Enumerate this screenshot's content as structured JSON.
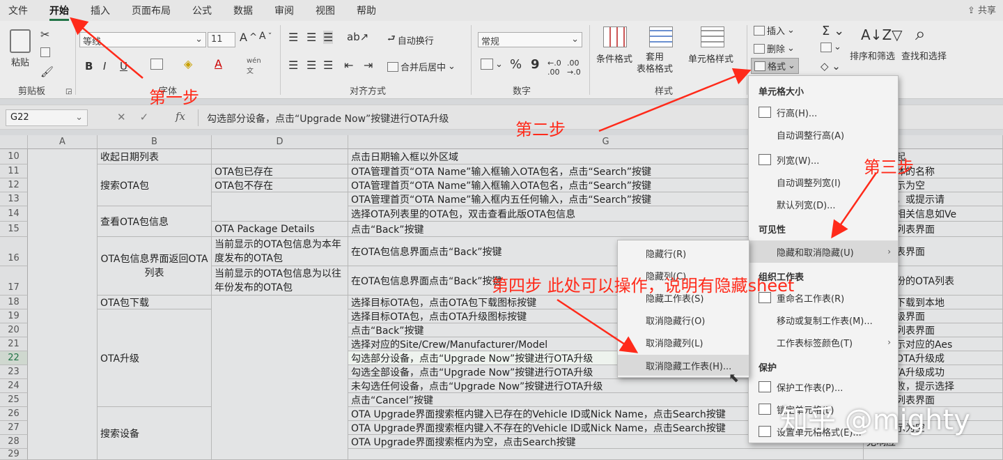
{
  "menubar": {
    "items": [
      "文件",
      "开始",
      "插入",
      "页面布局",
      "公式",
      "数据",
      "审阅",
      "视图",
      "帮助"
    ],
    "share": "共享"
  },
  "ribbon": {
    "clipboard": {
      "paste": "粘贴",
      "label": "剪贴板"
    },
    "font": {
      "name": "等线",
      "size": "11",
      "bold": "B",
      "italic": "I",
      "underline": "U",
      "label": "字体"
    },
    "alignment": {
      "wrap": "自动换行",
      "merge": "合并后居中",
      "label": "对齐方式"
    },
    "number": {
      "format": "常规",
      "percent": "%",
      "comma": "9",
      "label": "数字"
    },
    "styles": {
      "conditional": "条件格式",
      "table": "套用\n表格格式",
      "cell": "单元格样式",
      "label": "样式"
    },
    "cells": {
      "insert": "插入",
      "delete": "删除",
      "format": "格式"
    },
    "editing": {
      "sort": "排序和筛选",
      "find": "查找和选择"
    }
  },
  "formula_bar": {
    "namebox": "G22",
    "fx": "fx",
    "content": "勾选部分设备，点击“Upgrade Now”按键进行OTA升级"
  },
  "columns": [
    "A",
    "B",
    "D",
    "G"
  ],
  "rows": [
    "10",
    "11",
    "12",
    "13",
    "14",
    "15",
    "16",
    "17",
    "18",
    "19",
    "20",
    "21",
    "22",
    "23",
    "24",
    "25",
    "26",
    "27",
    "28",
    "29"
  ],
  "cells": {
    "b10": "收起日期列表",
    "b_search": "搜索OTA包",
    "b_view": "查看OTA包信息",
    "b_return": "OTA包信息界面返回OTA列表",
    "b18": "OTA包下载",
    "b_upgrade": "OTA升级",
    "b_device": "搜索设备",
    "d11": "OTA包已存在",
    "d12": "OTA包不存在",
    "d15": "OTA Package Details",
    "d16": "当前显示的OTA包信息为本年度发布的OTA包",
    "d17": "当前显示的OTA包信息为以往年份发布的OTA包",
    "g10": "点击日期输入框以外区域",
    "g11": "OTA管理首页“OTA Name”输入框输入OTA包名，点击“Search”按键",
    "g12": "OTA管理首页“OTA Name”输入框输入OTA包名，点击“Search”按键",
    "g13": "OTA管理首页“OTA Name”输入框内五任何输入，点击“Search”按键",
    "g14": "选择OTA列表里的OTA包，双击查看此版OTA包信息",
    "g15": "点击“Back”按键",
    "g16": "在OTA包信息界面点击“Back”按键",
    "g17": "在OTA包信息界面点击“Back”按键",
    "g18": "选择目标OTA包，点击OTA包下载图标按键",
    "g19": "选择目标OTA包，点击OTA升级图标按键",
    "g20": "点击“Back”按键",
    "g21": "选择对应的Site/Crew/Manufacturer/Model",
    "g22": "勾选部分设备，点击“Upgrade Now”按键进行OTA升级",
    "g23": "勾选全部设备，点击“Upgrade Now”按键进行OTA升级",
    "g24": "未勾选任何设备，点击“Upgrade Now”按键进行OTA升级",
    "g25": "点击“Cancel”按键",
    "g26": "OTA Upgrade界面搜索框内键入已存在的Vehicle ID或Nick Name，点击Search按键",
    "g27": "OTA Upgrade界面搜索框内键入不存在的Vehicle ID或Nick Name，点击Search按键",
    "g28": "OTA Upgrade界面搜索框内为空，点击Search按键",
    "h10": "列表收起",
    "h11": "显示具体的名称",
    "h12": "列表显示为空",
    "h13": "无响应，或提示请",
    "h14": "OTA包相关信息如Ve",
    "h15": "OTA包列表界面",
    "h16": "OTA列表界面",
    "h17": "以往年份的OTA列表",
    "h18": "OTA包下载到本地",
    "h19": "OTA升级界面",
    "h20": "OTA包列表界面",
    "h21": "列表显示对应的Aes",
    "h22": "的设备OTA升级成",
    "h23": "设备OTA升级成功",
    "h24": "升级失败，提示选择",
    "h25": "OTA包列表界面",
    "h27": "列表显示为空",
    "h28": "无响应"
  },
  "format_menu": {
    "cell_size": "单元格大小",
    "row_height": "行高(H)...",
    "autofit_row": "自动调整行高(A)",
    "col_width": "列宽(W)...",
    "autofit_col": "自动调整列宽(I)",
    "default_width": "默认列宽(D)...",
    "visibility": "可见性",
    "hide_unhide": "隐藏和取消隐藏(U)",
    "organize": "组织工作表",
    "rename": "重命名工作表(R)",
    "move_copy": "移动或复制工作表(M)...",
    "tab_color": "工作表标签颜色(T)",
    "protection": "保护",
    "protect": "保护工作表(P)...",
    "lock": "锁定单元格(L)",
    "format_cells": "设置单元格格式(E)..."
  },
  "hide_menu": {
    "hide_rows": "隐藏行(R)",
    "hide_cols": "隐藏列(C)",
    "hide_sheet": "隐藏工作表(S)",
    "unhide_rows": "取消隐藏行(O)",
    "unhide_cols": "取消隐藏列(L)",
    "unhide_sheet": "取消隐藏工作表(H)..."
  },
  "annotations": {
    "step1": "第一步",
    "step2": "第二步",
    "step3": "第三步",
    "step4": "第四步 此处可以操作，说明有隐藏sheet"
  },
  "watermark": "知乎 @mighty",
  "colors": {
    "accent": "#217346",
    "annotation": "#ff2a1a"
  }
}
